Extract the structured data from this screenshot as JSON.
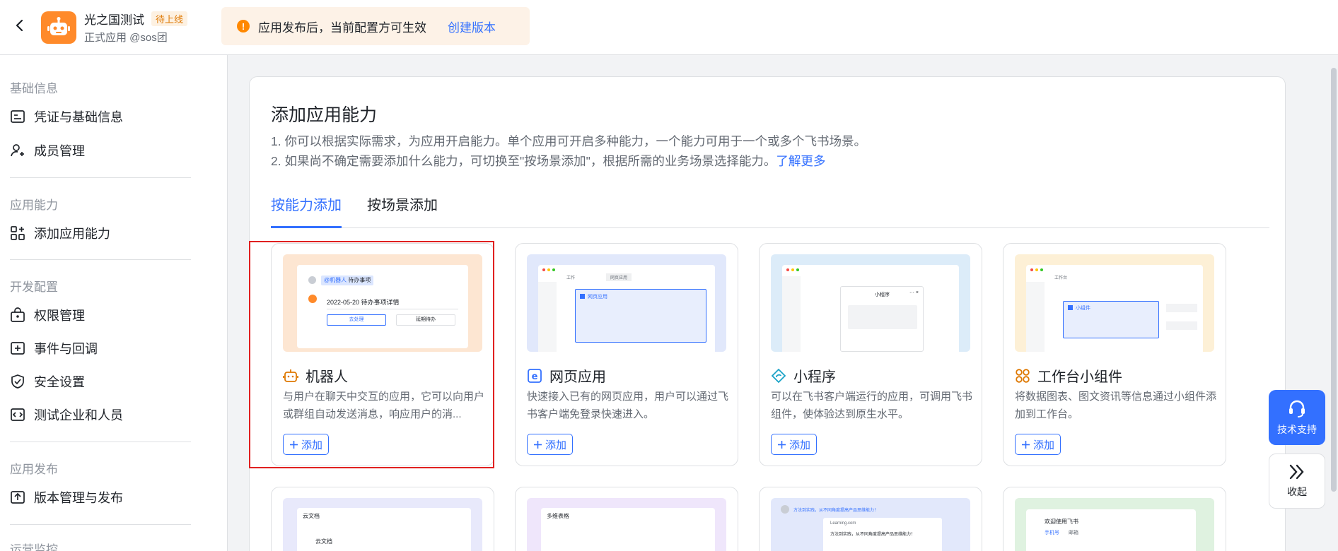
{
  "header": {
    "app_name": "光之国测试",
    "status_tag": "待上线",
    "app_sub": "正式应用 @sos团",
    "notice_text": "应用发布后，当前配置方可生效",
    "notice_link": "创建版本"
  },
  "sidebar": {
    "sections": [
      {
        "title": "基础信息",
        "items": [
          {
            "label": "凭证与基础信息",
            "icon": "id-card-icon"
          },
          {
            "label": "成员管理",
            "icon": "member-add-icon"
          }
        ]
      },
      {
        "title": "应用能力",
        "items": [
          {
            "label": "添加应用能力",
            "icon": "grid-add-icon"
          }
        ]
      },
      {
        "title": "开发配置",
        "items": [
          {
            "label": "权限管理",
            "icon": "lock-bag-icon"
          },
          {
            "label": "事件与回调",
            "icon": "event-plus-icon"
          },
          {
            "label": "安全设置",
            "icon": "shield-check-icon"
          },
          {
            "label": "测试企业和人员",
            "icon": "code-box-icon"
          }
        ]
      },
      {
        "title": "应用发布",
        "items": [
          {
            "label": "版本管理与发布",
            "icon": "upload-box-icon"
          }
        ]
      },
      {
        "title": "运营监控",
        "items": []
      }
    ]
  },
  "main": {
    "title": "添加应用能力",
    "desc1": "1. 你可以根据实际需求，为应用开启能力。单个应用可开启多种能力，一个能力可用于一个或多个飞书场景。",
    "desc2_prefix": "2. 如果尚不确定需要添加什么能力，可切换至\"按场景添加\"，根据所需的业务场景选择能力。",
    "desc2_link": "了解更多",
    "tabs": [
      {
        "label": "按能力添加",
        "active": true
      },
      {
        "label": "按场景添加",
        "active": false
      }
    ],
    "cards": [
      {
        "title": "机器人",
        "icon": "robot-icon",
        "desc": "与用户在聊天中交互的应用，它可以向用户或群组自动发送消息，响应用户的消...",
        "add_label": "添加",
        "preview_color": "#fde6d2",
        "preview": {
          "chip": "@机器人",
          "chip_text": "待办事项",
          "line": "2022-05-20 待办事项详情",
          "btn1": "去处理",
          "btn2": "延期待办"
        }
      },
      {
        "title": "网页应用",
        "icon": "web-e-icon",
        "desc": "快速接入已有的网页应用，用户可以通过飞书客户端免登录快速进入。",
        "add_label": "添加",
        "preview_color": "#e1e8fb",
        "preview": {
          "tab1": "工作",
          "tab2": "网页应用",
          "label": "网页应用"
        }
      },
      {
        "title": "小程序",
        "icon": "mini-program-icon",
        "desc": "可以在飞书客户端运行的应用，可调用飞书组件，使体验达到原生水平。",
        "add_label": "添加",
        "preview_color": "#dcecf9",
        "preview": {
          "label": "小程序",
          "menu": "··· ×"
        }
      },
      {
        "title": "工作台小组件",
        "icon": "widget-icon",
        "desc": "将数据图表、图文资讯等信息通过小组件添加到工作台。",
        "add_label": "添加",
        "preview_color": "#fdf0d6",
        "preview": {
          "tab1": "工作台",
          "label": "小组件"
        }
      }
    ],
    "cards_row2": [
      {
        "preview_color": "#e8e9fb",
        "label": "云文档",
        "sub": "云文档"
      },
      {
        "preview_color": "#efe6fb",
        "label": "多维表格"
      },
      {
        "preview_color": "#e2e8fb",
        "banner": "方法到实践，从不同角度提高产品思维能力！",
        "site": "Learning.com",
        "snippet": "方法到实践，从不同角度提高产品思维能力！"
      },
      {
        "preview_color": "#dff2e0",
        "label": "欢迎使用飞书",
        "tab1": "手机号",
        "tab2": "邮箱"
      }
    ]
  },
  "floating": {
    "support_label": "技术支持",
    "collapse_label": "收起"
  },
  "colors": {
    "accent": "#3370ff",
    "brand_orange": "#ff8a2a",
    "highlight": "#e02020"
  }
}
